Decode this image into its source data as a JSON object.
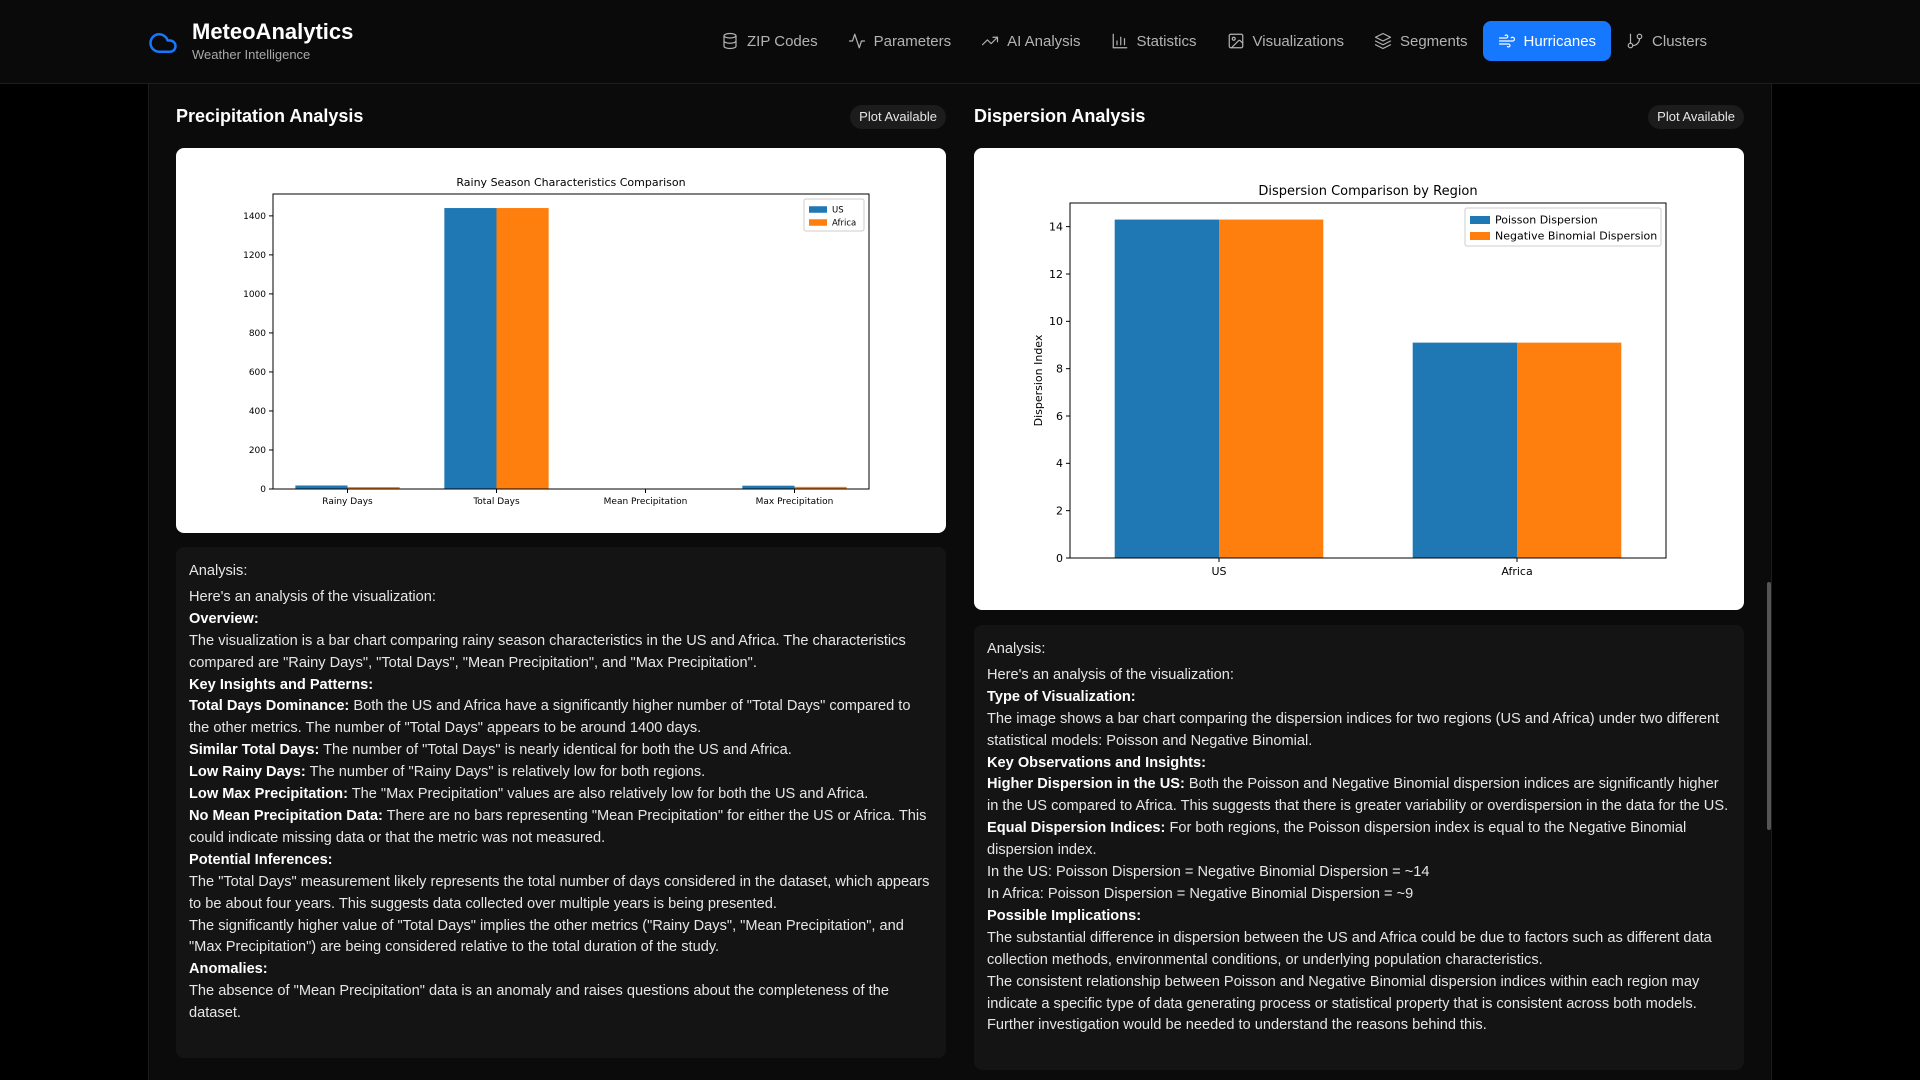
{
  "app": {
    "name": "MeteoAnalytics",
    "subtitle": "Weather Intelligence"
  },
  "nav": [
    {
      "label": "ZIP Codes",
      "icon": "database-icon",
      "active": false
    },
    {
      "label": "Parameters",
      "icon": "activity-icon",
      "active": false
    },
    {
      "label": "AI Analysis",
      "icon": "trending-up-icon",
      "active": false
    },
    {
      "label": "Statistics",
      "icon": "bar-chart-icon",
      "active": false
    },
    {
      "label": "Visualizations",
      "icon": "image-icon",
      "active": false
    },
    {
      "label": "Segments",
      "icon": "layers-icon",
      "active": false
    },
    {
      "label": "Hurricanes",
      "icon": "wind-icon",
      "active": true
    },
    {
      "label": "Clusters",
      "icon": "git-branch-icon",
      "active": false
    }
  ],
  "colors": {
    "accent": "#1677ff",
    "series_blue": "#1f77b4",
    "series_orange": "#ff7f0e"
  },
  "left": {
    "title": "Precipitation Analysis",
    "badge": "Plot Available",
    "analysis_label": "Analysis:",
    "intro": "Here's an analysis of the visualization:",
    "s1_head": "Overview:",
    "s1_text": "The visualization is a bar chart comparing rainy season characteristics in the US and Africa. The characteristics compared are \"Rainy Days\", \"Total Days\", \"Mean Precipitation\", and \"Max Precipitation\".",
    "s2_head": "Key Insights and Patterns:",
    "b1_head": "Total Days Dominance:",
    "b1_text": " Both the US and Africa have a significantly higher number of \"Total Days\" compared to the other metrics. The number of \"Total Days\" appears to be around 1400 days.",
    "b2_head": "Similar Total Days:",
    "b2_text": " The number of \"Total Days\" is nearly identical for both the US and Africa.",
    "b3_head": "Low Rainy Days:",
    "b3_text": " The number of \"Rainy Days\" is relatively low for both regions.",
    "b4_head": "Low Max Precipitation:",
    "b4_text": " The \"Max Precipitation\" values are also relatively low for both the US and Africa.",
    "b5_head": "No Mean Precipitation Data:",
    "b5_text": " There are no bars representing \"Mean Precipitation\" for either the US or Africa. This could indicate missing data or that the metric was not measured.",
    "s3_head": "Potential Inferences:",
    "p1": "The \"Total Days\" measurement likely represents the total number of days considered in the dataset, which appears to be about four years. This suggests data collected over multiple years is being presented.",
    "p2": "The significantly higher value of \"Total Days\" implies the other metrics (\"Rainy Days\", \"Mean Precipitation\", and \"Max Precipitation\") are being considered relative to the total duration of the study.",
    "s4_head": "Anomalies:",
    "p3": "The absence of \"Mean Precipitation\" data is an anomaly and raises questions about the completeness of the dataset."
  },
  "right": {
    "title": "Dispersion Analysis",
    "badge": "Plot Available",
    "analysis_label": "Analysis:",
    "intro": "Here's an analysis of the visualization:",
    "s1_head": "Type of Visualization:",
    "s1_text": "The image shows a bar chart comparing the dispersion indices for two regions (US and Africa) under two different statistical models: Poisson and Negative Binomial.",
    "s2_head": "Key Observations and Insights:",
    "b1_head": "Higher Dispersion in the US:",
    "b1_text": " Both the Poisson and Negative Binomial dispersion indices are significantly higher in the US compared to Africa. This suggests that there is greater variability or overdispersion in the data for the US.",
    "b2_head": "Equal Dispersion Indices:",
    "b2_text": " For both regions, the Poisson dispersion index is equal to the Negative Binomial dispersion index.",
    "l1": "In the US: Poisson Dispersion = Negative Binomial Dispersion = ~14",
    "l2": "In Africa: Poisson Dispersion = Negative Binomial Dispersion = ~9",
    "s3_head": "Possible Implications:",
    "p1": "The substantial difference in dispersion between the US and Africa could be due to factors such as different data collection methods, environmental conditions, or underlying population characteristics.",
    "p2": "The consistent relationship between Poisson and Negative Binomial dispersion indices within each region may indicate a specific type of data generating process or statistical property that is consistent across both models. Further investigation would be needed to understand the reasons behind this."
  },
  "chart_data": [
    {
      "type": "bar",
      "title": "Rainy Season Characteristics Comparison",
      "xlabel": "",
      "ylabel": "",
      "categories": [
        "Rainy Days",
        "Total Days",
        "Mean Precipitation",
        "Max Precipitation"
      ],
      "series": [
        {
          "name": "US",
          "color": "#1f77b4",
          "values": [
            18,
            1440,
            0.5,
            17
          ]
        },
        {
          "name": "Africa",
          "color": "#ff7f0e",
          "values": [
            10,
            1440,
            0.4,
            11
          ]
        }
      ],
      "ylim": [
        0,
        1512
      ],
      "yticks": [
        0,
        200,
        400,
        600,
        800,
        1000,
        1200,
        1400
      ],
      "legend": "top-right",
      "grid": false
    },
    {
      "type": "bar",
      "title": "Dispersion Comparison by Region",
      "xlabel": "",
      "ylabel": "Dispersion Index",
      "categories": [
        "US",
        "Africa"
      ],
      "series": [
        {
          "name": "Poisson Dispersion",
          "color": "#1f77b4",
          "values": [
            14.3,
            9.1
          ]
        },
        {
          "name": "Negative Binomial Dispersion",
          "color": "#ff7f0e",
          "values": [
            14.3,
            9.1
          ]
        }
      ],
      "ylim": [
        0,
        15
      ],
      "yticks": [
        0,
        2,
        4,
        6,
        8,
        10,
        12,
        14
      ],
      "legend": "top-right",
      "grid": false
    }
  ]
}
